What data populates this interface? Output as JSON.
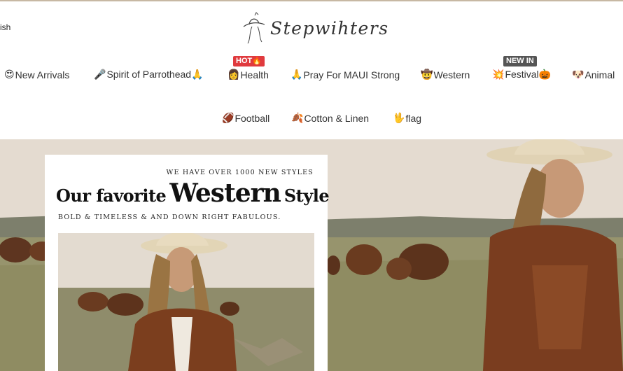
{
  "header": {
    "language_label": "ish",
    "logo_text": "Stepwihters"
  },
  "nav": {
    "row1": [
      {
        "emoji": "😍",
        "label": "New Arrivals"
      },
      {
        "emoji": "🎤",
        "label": "Spirit of Parrothead🙏"
      },
      {
        "emoji": "👩",
        "label": "Health",
        "badge": "HOT🔥"
      },
      {
        "emoji": "🙏",
        "label": "Pray For MAUI Strong"
      },
      {
        "emoji": "🤠",
        "label": "Western"
      },
      {
        "emoji": "💥",
        "label": "Festival🎃",
        "badge": "NEW IN"
      },
      {
        "emoji": "🐶",
        "label": "Animal"
      }
    ],
    "row2": [
      {
        "emoji": "🏈",
        "label": "Football"
      },
      {
        "emoji": "🍂",
        "label": "Cotton & Linen"
      },
      {
        "emoji": "🖖",
        "label": "flag"
      }
    ]
  },
  "hero": {
    "kicker": "WE HAVE OVER 1000 NEW STYLES",
    "headline_part1": "Our favorite",
    "headline_part2": "Western",
    "headline_part3": "Style",
    "subline": "BOLD & TIMELESS & AND DOWN RIGHT FABULOUS."
  },
  "colors": {
    "hot_badge": "#e03a3e",
    "new_badge": "#555555",
    "top_rule": "#c7b8a3"
  }
}
